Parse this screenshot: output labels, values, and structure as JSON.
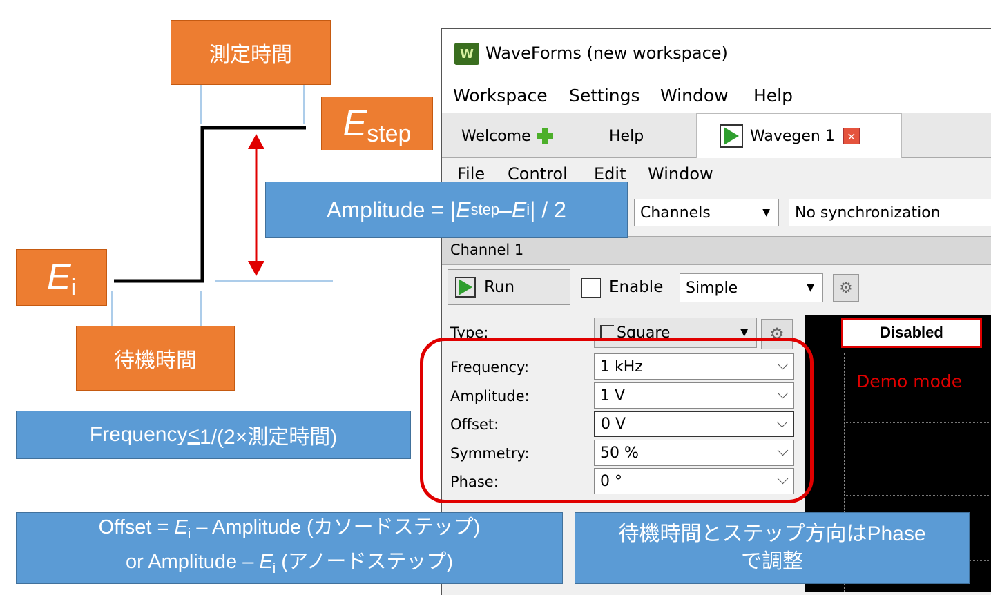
{
  "diagram": {
    "measure_time_label": "測定時間",
    "wait_time_label": "待機時間",
    "e_step": {
      "main": "E",
      "sub": "step"
    },
    "e_i": {
      "main": "E",
      "sub": "i"
    },
    "amplitude_box": {
      "prefix": "Amplitude = |",
      "e1": "E",
      "s1": "step",
      "mid": " – ",
      "e2": "E",
      "s2": "i",
      "suffix": "| / 2"
    },
    "frequency_box": {
      "pre": "Frequency ",
      "le": "<",
      "post": " 1/(2×測定時間)"
    },
    "offset_box": {
      "l1a": "Offset = ",
      "l1e": "E",
      "l1s": "i",
      "l1b": " – Amplitude (カソードステップ)",
      "l2a": "or  Amplitude – ",
      "l2e": "E",
      "l2s": "i",
      "l2b": " (アノードステップ)"
    },
    "phase_box": {
      "line1": "待機時間とステップ方向はPhase",
      "line2": "で調整"
    },
    "colors": {
      "orange": "#ED7D31",
      "blue": "#5B9BD5",
      "arrow": "#e00000",
      "highlight": "#e00000"
    }
  },
  "window": {
    "title": "WaveForms  (new workspace)",
    "menu": [
      "Workspace",
      "Settings",
      "Window",
      "Help"
    ],
    "tabs": {
      "welcome": "Welcome",
      "help": "Help",
      "wavegen": "Wavegen 1"
    },
    "submenu": [
      "File",
      "Control",
      "Edit",
      "Window"
    ],
    "channels_select": "Channels",
    "sync_select": "No synchronization",
    "channel_header": "Channel 1",
    "run_label": "Run",
    "enable_label": "Enable",
    "mode_select": "Simple",
    "params": {
      "type": {
        "label": "Type:",
        "value": "Square"
      },
      "frequency": {
        "label": "Frequency:",
        "value": "1  kHz"
      },
      "amplitude": {
        "label": "Amplitude:",
        "value": "1  V"
      },
      "offset": {
        "label": "Offset:",
        "value": "0  V"
      },
      "symmetry": {
        "label": "Symmetry:",
        "value": "50  %"
      },
      "phase": {
        "label": "Phase:",
        "value": "0  °"
      }
    },
    "scope": {
      "status": "Disabled",
      "demo": "Demo mode"
    }
  }
}
